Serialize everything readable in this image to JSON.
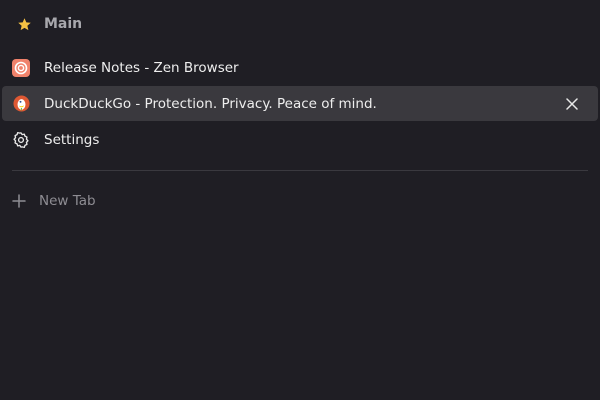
{
  "workspace": {
    "title": "Main",
    "icon": "star-icon",
    "icon_color": "#f5c243"
  },
  "tabs": [
    {
      "label": "Release Notes - Zen Browser",
      "icon": "zen-favicon",
      "active": false
    },
    {
      "label": "DuckDuckGo - Protection. Privacy. Peace of mind.",
      "icon": "duckduckgo-favicon",
      "active": true
    },
    {
      "label": "Settings",
      "icon": "gear-icon",
      "active": false
    }
  ],
  "new_tab": {
    "label": "New Tab",
    "icon": "plus-icon"
  },
  "colors": {
    "background": "#1f1e24",
    "active_tab": "#3a393e",
    "zen_orange": "#f0826b",
    "duckduckgo_orange": "#de5833"
  }
}
